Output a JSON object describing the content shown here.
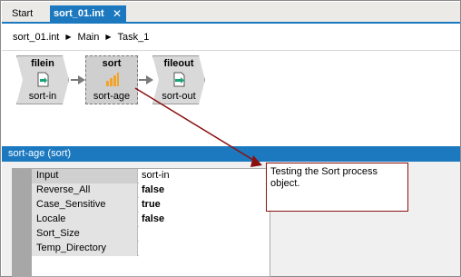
{
  "tabs": [
    {
      "label": "Start",
      "active": false
    },
    {
      "label": "sort_01.int",
      "active": true,
      "close_glyph": "✕"
    }
  ],
  "breadcrumb": [
    "sort_01.int",
    "Main",
    "Task_1"
  ],
  "breadcrumb_sep": "▶",
  "nodes": {
    "filein": {
      "title": "filein",
      "label": "sort-in",
      "icon": "file-input-icon"
    },
    "sort": {
      "title": "sort",
      "label": "sort-age",
      "icon": "sort-bars-icon"
    },
    "fileout": {
      "title": "fileout",
      "label": "sort-out",
      "icon": "file-output-icon"
    }
  },
  "panel": {
    "title": "sort-age (sort)"
  },
  "properties": [
    {
      "name": "Input",
      "value": "sort-in",
      "bold": false
    },
    {
      "name": "Reverse_All",
      "value": "false",
      "bold": true
    },
    {
      "name": "Case_Sensitive",
      "value": "true",
      "bold": true
    },
    {
      "name": "Locale",
      "value": "false",
      "bold": true
    },
    {
      "name": "Sort_Size",
      "value": "",
      "bold": false
    },
    {
      "name": "Temp_Directory",
      "value": "",
      "bold": false
    }
  ],
  "note": {
    "text": "Testing the Sort process object."
  },
  "colors": {
    "accent": "#1c79bf",
    "note_line": "#8a1010",
    "node_fill": "#d9d9d9",
    "icon_green": "#1aa37a",
    "icon_orange": "#f2a42a"
  }
}
